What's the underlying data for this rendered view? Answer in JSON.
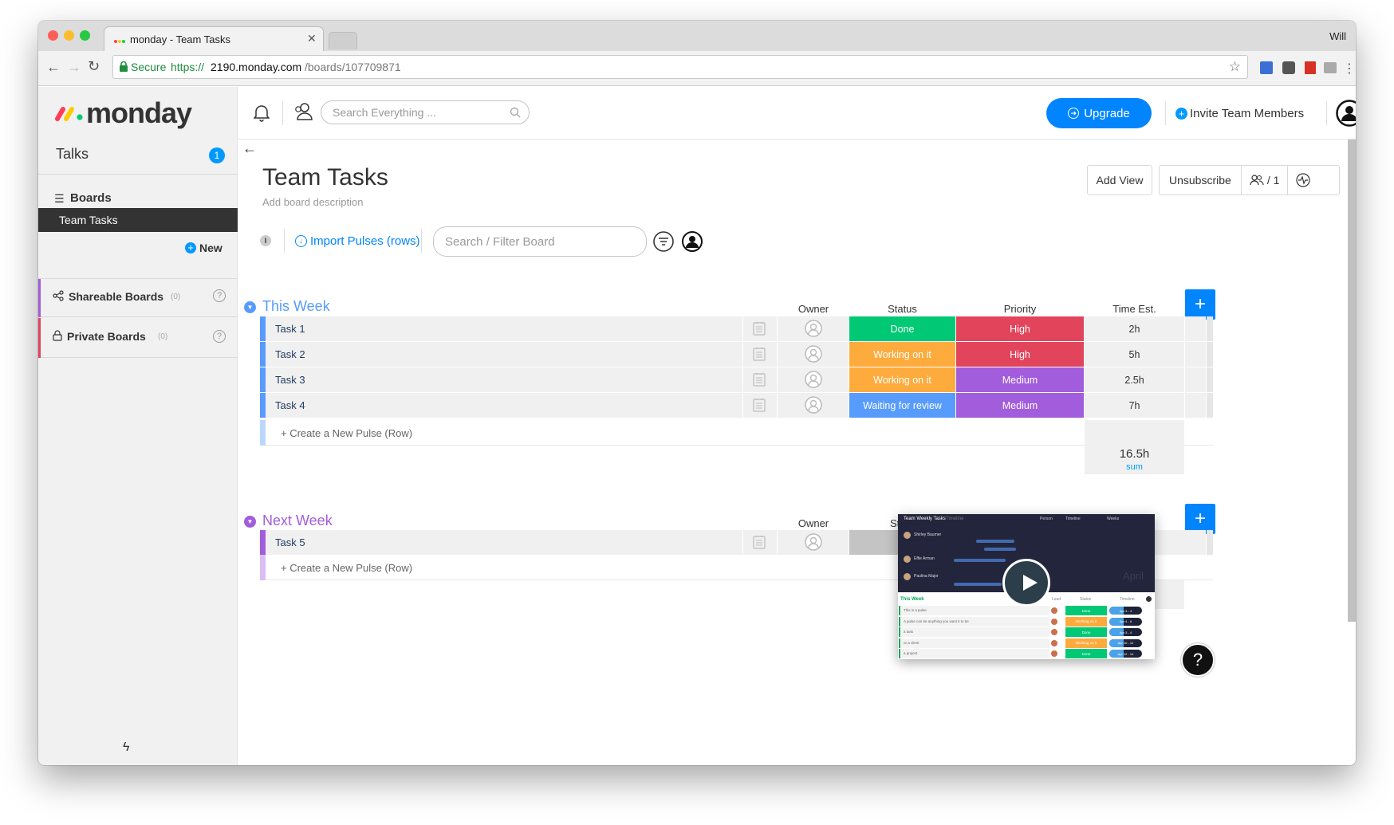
{
  "browser": {
    "tab_title": "monday - Team Tasks",
    "user_name": "Will",
    "secure_label": "Secure",
    "url_scheme": "https://",
    "url_host": "2190.monday.com",
    "url_path": "/boards/107709871"
  },
  "sidebar": {
    "logo_text": "monday",
    "talks_label": "Talks",
    "talks_badge": "1",
    "boards_label": "Boards",
    "active_board": "Team Tasks",
    "new_label": "New",
    "shareable_label": "Shareable Boards",
    "shareable_count": "(0)",
    "private_label": "Private Boards",
    "private_count": "(0)"
  },
  "topbar": {
    "search_placeholder": "Search Everything ...",
    "upgrade_label": "Upgrade",
    "invite_label": "Invite Team Members"
  },
  "board": {
    "title": "Team Tasks",
    "description": "Add board description",
    "add_view": "Add View",
    "unsubscribe": "Unsubscribe",
    "members_count": "/ 1",
    "import_label": "Import Pulses (rows)",
    "filter_placeholder": "Search / Filter Board",
    "info_badge": "I"
  },
  "columns": {
    "owner": "Owner",
    "status": "Status",
    "priority": "Priority",
    "time": "Time Est."
  },
  "groups": [
    {
      "name": "This Week",
      "color": "#579bfc",
      "rows": [
        {
          "name": "Task 1",
          "status": "Done",
          "status_color": "#00c875",
          "priority": "High",
          "priority_color": "#e2445c",
          "time": "2h"
        },
        {
          "name": "Task 2",
          "status": "Working on it",
          "status_color": "#fdab3d",
          "priority": "High",
          "priority_color": "#e2445c",
          "time": "5h"
        },
        {
          "name": "Task 3",
          "status": "Working on it",
          "status_color": "#fdab3d",
          "priority": "Medium",
          "priority_color": "#a25ddc",
          "time": "2.5h"
        },
        {
          "name": "Task 4",
          "status": "Waiting for review",
          "status_color": "#579bfc",
          "priority": "Medium",
          "priority_color": "#a25ddc",
          "time": "7h"
        }
      ],
      "create_label": "+ Create a New Pulse (Row)",
      "sum_value": "16.5h",
      "sum_label": "sum"
    },
    {
      "name": "Next Week",
      "color": "#a25ddc",
      "owner_header": "Owner",
      "status_header_partial": "St",
      "rows": [
        {
          "name": "Task 5",
          "status": "",
          "status_color": "#c4c4c4"
        }
      ],
      "create_label": "+ Create a New Pulse (Row)"
    }
  ],
  "video": {
    "title": "Team Weekly Tasks",
    "subtitle": "Timeline",
    "tool_person": "Person",
    "tool_timeline": "Timeline",
    "tool_weeks": "Weeks",
    "people": [
      "Shirley Baumer",
      "Effie Arman",
      "Paulina Major"
    ],
    "month": "April",
    "group": "This Week",
    "head_lead": "Lead",
    "head_status": "Status",
    "head_timeline": "Timeline",
    "rows": [
      {
        "name": "This is a pulse",
        "status": "Done",
        "color": "#00c875",
        "range": "Apr 3 - 4"
      },
      {
        "name": "A pulse can be anything you want it to be",
        "status": "Working on it",
        "color": "#fdab3d",
        "range": "Apr 4 - 6"
      },
      {
        "name": "a task",
        "status": "Done",
        "color": "#00c875",
        "range": "Apr 3 - 4"
      },
      {
        "name": "or a client",
        "status": "Working on it",
        "color": "#fdab3d",
        "range": "Apr 10 - 12"
      },
      {
        "name": "a project",
        "status": "Done",
        "color": "#00c875",
        "range": "Apr 12 - 14"
      }
    ]
  },
  "help": {
    "label": "?"
  },
  "colors": {
    "accent": "#0085ff",
    "sidebar_active": "#333333",
    "badge": "#009aff",
    "shareable_stripe": "#a25ddc",
    "private_stripe": "#e2445c"
  }
}
